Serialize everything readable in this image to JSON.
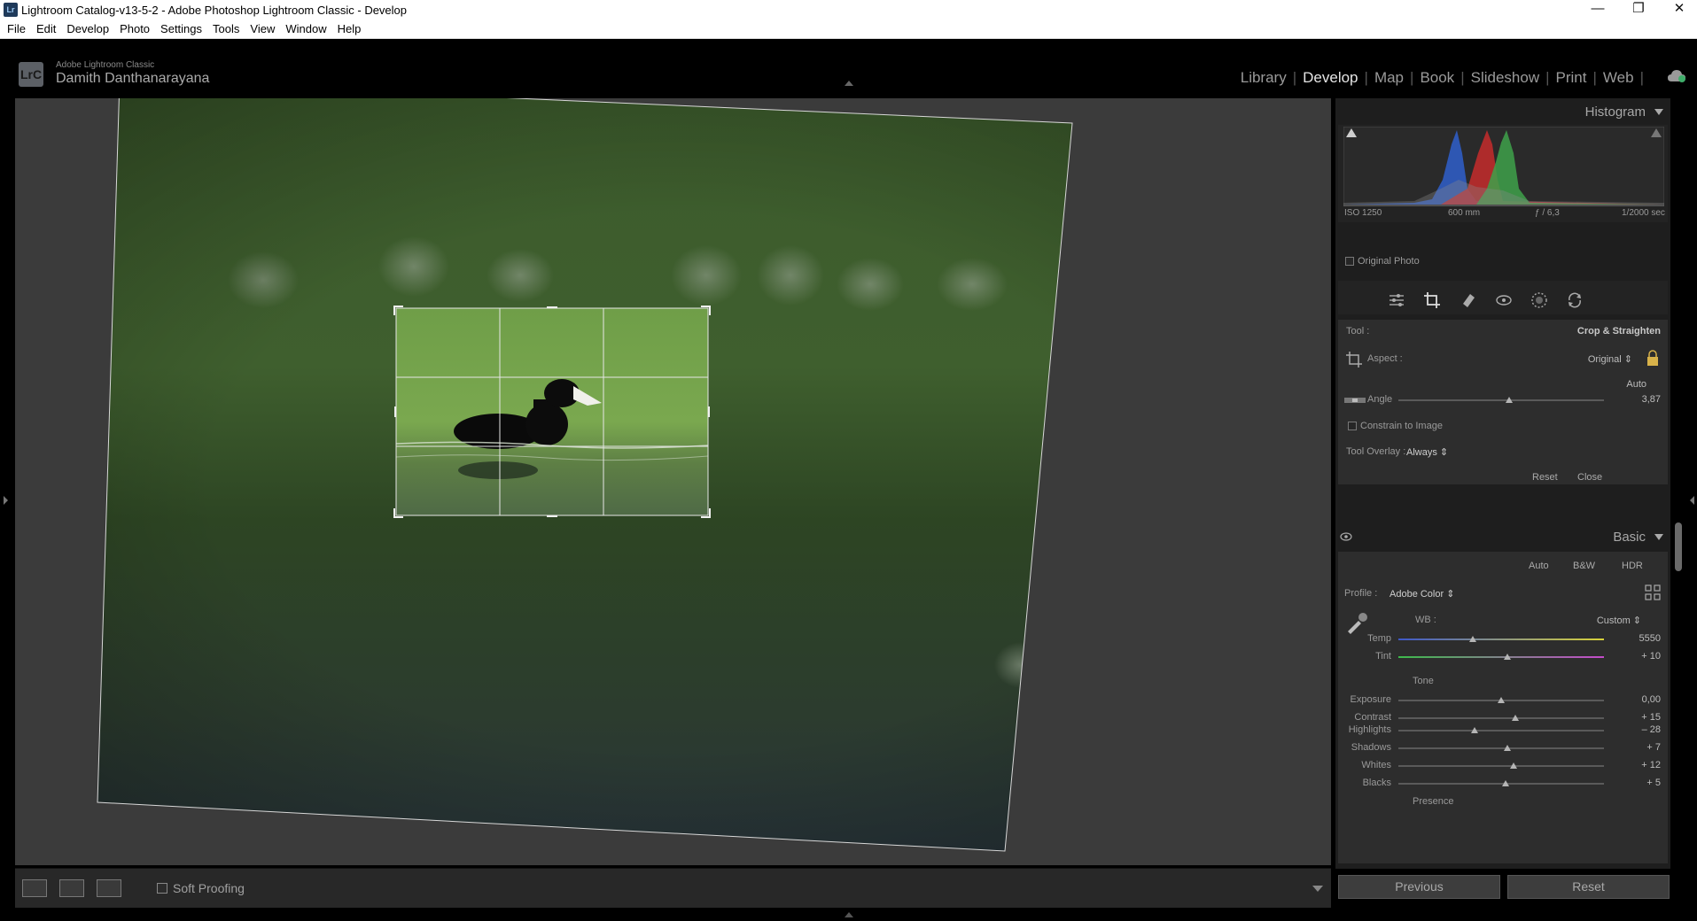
{
  "window": {
    "title": "Lightroom Catalog-v13-5-2 - Adobe Photoshop Lightroom Classic - Develop",
    "minimize": "—",
    "restore": "❐",
    "close": "✕"
  },
  "menu": [
    "File",
    "Edit",
    "Develop",
    "Photo",
    "Settings",
    "Tools",
    "View",
    "Window",
    "Help"
  ],
  "identity": {
    "logo": "LrC",
    "product": "Adobe Lightroom Classic",
    "user": "Damith Danthanarayana"
  },
  "modules": [
    "Library",
    "Develop",
    "Map",
    "Book",
    "Slideshow",
    "Print",
    "Web"
  ],
  "active_module": "Develop",
  "histogram": {
    "header": "Histogram",
    "iso": "ISO 1250",
    "focal": "600 mm",
    "aperture": "ƒ / 6,3",
    "shutter": "1/2000 sec",
    "original_photo": "Original Photo"
  },
  "crop": {
    "tool_label": "Tool :",
    "tool_value": "Crop & Straighten",
    "aspect_label": "Aspect :",
    "aspect_value": "Original ⇕",
    "auto": "Auto",
    "angle_label": "Angle",
    "angle_value": "3,87",
    "angle_fraction": 0.54,
    "constrain": "Constrain to Image",
    "overlay_label": "Tool Overlay :",
    "overlay_value": "Always ⇕",
    "reset": "Reset",
    "close": "Close"
  },
  "basic": {
    "header": "Basic",
    "auto": "Auto",
    "bw": "B&W",
    "hdr": "HDR",
    "profile_label": "Profile :",
    "profile_value": "Adobe Color ⇕",
    "wb_label": "WB :",
    "wb_value": "Custom ⇕",
    "tone": "Tone",
    "presence": "Presence",
    "sliders_wb": [
      {
        "label": "Temp",
        "value": "5550",
        "pos": 0.36
      },
      {
        "label": "Tint",
        "value": "+ 10",
        "pos": 0.53
      }
    ],
    "sliders_tone": [
      {
        "label": "Exposure",
        "value": "0,00",
        "pos": 0.5
      },
      {
        "label": "Contrast",
        "value": "+ 15",
        "pos": 0.57
      }
    ],
    "sliders_tone2": [
      {
        "label": "Highlights",
        "value": "– 28",
        "pos": 0.37
      },
      {
        "label": "Shadows",
        "value": "+ 7",
        "pos": 0.53
      },
      {
        "label": "Whites",
        "value": "+ 12",
        "pos": 0.56
      },
      {
        "label": "Blacks",
        "value": "+ 5",
        "pos": 0.52
      }
    ]
  },
  "bottom": {
    "soft_proofing": "Soft Proofing",
    "previous": "Previous",
    "reset": "Reset"
  },
  "colors": {
    "panel": "#2d2d2d",
    "background": "#3b3b3b",
    "accent_text": "#e5e5e5"
  }
}
